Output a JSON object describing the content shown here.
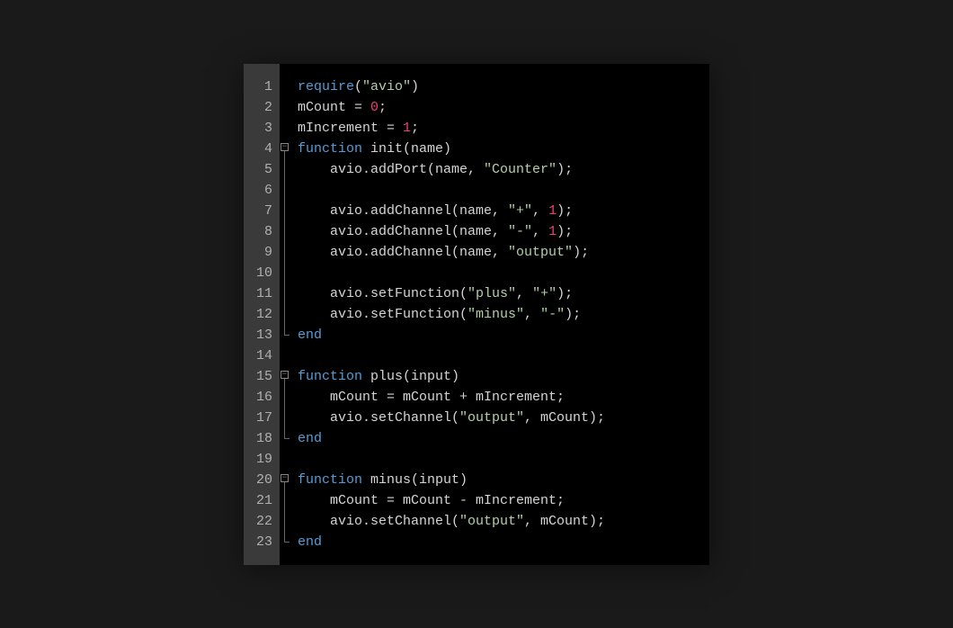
{
  "editor": {
    "lineNumbers": [
      "1",
      "2",
      "3",
      "4",
      "5",
      "6",
      "7",
      "8",
      "9",
      "10",
      "11",
      "12",
      "13",
      "14",
      "15",
      "16",
      "17",
      "18",
      "19",
      "20",
      "21",
      "22",
      "23"
    ],
    "foldMarkers": {
      "4": "start",
      "5": "mid",
      "6": "mid",
      "7": "mid",
      "8": "mid",
      "9": "mid",
      "10": "mid",
      "11": "mid",
      "12": "mid",
      "13": "end",
      "15": "start",
      "16": "mid",
      "17": "mid",
      "18": "end",
      "20": "start",
      "21": "mid",
      "22": "mid",
      "23": "end"
    },
    "foldSymbol": "−",
    "lines": [
      [
        {
          "t": "require",
          "c": "tk-keyword"
        },
        {
          "t": "(",
          "c": "tk-punct"
        },
        {
          "t": "\"avio\"",
          "c": "tk-string"
        },
        {
          "t": ")",
          "c": "tk-punct"
        }
      ],
      [
        {
          "t": "mCount = ",
          "c": "tk-identifier"
        },
        {
          "t": "0",
          "c": "tk-number"
        },
        {
          "t": ";",
          "c": "tk-punct"
        }
      ],
      [
        {
          "t": "mIncrement = ",
          "c": "tk-identifier"
        },
        {
          "t": "1",
          "c": "tk-number"
        },
        {
          "t": ";",
          "c": "tk-punct"
        }
      ],
      [
        {
          "t": "function",
          "c": "tk-keyword"
        },
        {
          "t": " init(name)",
          "c": "tk-identifier"
        }
      ],
      [
        {
          "t": "    avio.addPort(name, ",
          "c": "tk-identifier"
        },
        {
          "t": "\"Counter\"",
          "c": "tk-string"
        },
        {
          "t": ");",
          "c": "tk-punct"
        }
      ],
      [
        {
          "t": "    ",
          "c": "tk-identifier"
        }
      ],
      [
        {
          "t": "    avio.addChannel(name, ",
          "c": "tk-identifier"
        },
        {
          "t": "\"+\"",
          "c": "tk-string"
        },
        {
          "t": ", ",
          "c": "tk-punct"
        },
        {
          "t": "1",
          "c": "tk-number"
        },
        {
          "t": ");",
          "c": "tk-punct"
        }
      ],
      [
        {
          "t": "    avio.addChannel(name, ",
          "c": "tk-identifier"
        },
        {
          "t": "\"-\"",
          "c": "tk-string"
        },
        {
          "t": ", ",
          "c": "tk-punct"
        },
        {
          "t": "1",
          "c": "tk-number"
        },
        {
          "t": ");",
          "c": "tk-punct"
        }
      ],
      [
        {
          "t": "    avio.addChannel(name, ",
          "c": "tk-identifier"
        },
        {
          "t": "\"output\"",
          "c": "tk-string"
        },
        {
          "t": ");",
          "c": "tk-punct"
        }
      ],
      [
        {
          "t": "    ",
          "c": "tk-identifier"
        }
      ],
      [
        {
          "t": "    avio.setFunction(",
          "c": "tk-identifier"
        },
        {
          "t": "\"plus\"",
          "c": "tk-string"
        },
        {
          "t": ", ",
          "c": "tk-punct"
        },
        {
          "t": "\"+\"",
          "c": "tk-string"
        },
        {
          "t": ");",
          "c": "tk-punct"
        }
      ],
      [
        {
          "t": "    avio.setFunction(",
          "c": "tk-identifier"
        },
        {
          "t": "\"minus\"",
          "c": "tk-string"
        },
        {
          "t": ", ",
          "c": "tk-punct"
        },
        {
          "t": "\"-\"",
          "c": "tk-string"
        },
        {
          "t": ");",
          "c": "tk-punct"
        }
      ],
      [
        {
          "t": "end",
          "c": "tk-keyword"
        }
      ],
      [
        {
          "t": "",
          "c": "tk-identifier"
        }
      ],
      [
        {
          "t": "function",
          "c": "tk-keyword"
        },
        {
          "t": " plus(input)",
          "c": "tk-identifier"
        }
      ],
      [
        {
          "t": "    mCount = mCount + mIncrement;",
          "c": "tk-identifier"
        }
      ],
      [
        {
          "t": "    avio.setChannel(",
          "c": "tk-identifier"
        },
        {
          "t": "\"output\"",
          "c": "tk-string"
        },
        {
          "t": ", mCount);",
          "c": "tk-identifier"
        }
      ],
      [
        {
          "t": "end",
          "c": "tk-keyword"
        }
      ],
      [
        {
          "t": "",
          "c": "tk-identifier"
        }
      ],
      [
        {
          "t": "function",
          "c": "tk-keyword"
        },
        {
          "t": " minus(input)",
          "c": "tk-identifier"
        }
      ],
      [
        {
          "t": "    mCount = mCount - mIncrement;",
          "c": "tk-identifier"
        }
      ],
      [
        {
          "t": "    avio.setChannel(",
          "c": "tk-identifier"
        },
        {
          "t": "\"output\"",
          "c": "tk-string"
        },
        {
          "t": ", mCount);",
          "c": "tk-identifier"
        }
      ],
      [
        {
          "t": "end",
          "c": "tk-keyword"
        }
      ]
    ]
  }
}
